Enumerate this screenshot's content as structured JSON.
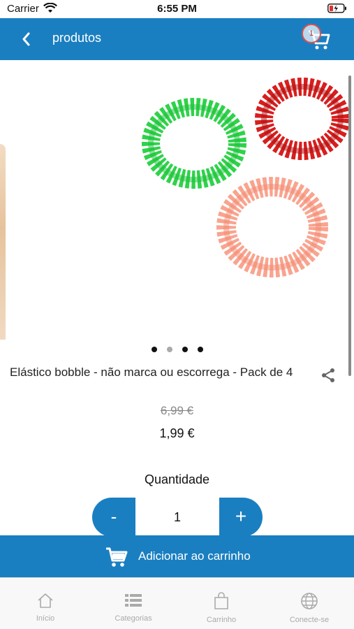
{
  "status_bar": {
    "carrier": "Carrier",
    "time": "6:55 PM"
  },
  "header": {
    "title": "produtos",
    "cart_count": "1"
  },
  "carousel": {
    "slide_count": 4,
    "active_index": 1
  },
  "product": {
    "title": "Elástico bobble - não marca ou escorrega - Pack de 4",
    "old_price": "6,99 €",
    "price": "1,99 €"
  },
  "quantity": {
    "label": "Quantidade",
    "value": "1",
    "minus": "-",
    "plus": "+"
  },
  "add_to_cart": {
    "label": "Adicionar ao carrinho"
  },
  "tabs": [
    {
      "label": "Início",
      "icon": "home-icon"
    },
    {
      "label": "Categorias",
      "icon": "list-icon"
    },
    {
      "label": "Carrinho",
      "icon": "bag-icon"
    },
    {
      "label": "Conecte-se",
      "icon": "globe-icon"
    }
  ],
  "colors": {
    "primary": "#1a7fc1",
    "tab_inactive": "#aaaaaa",
    "badge_border": "#e05050"
  }
}
